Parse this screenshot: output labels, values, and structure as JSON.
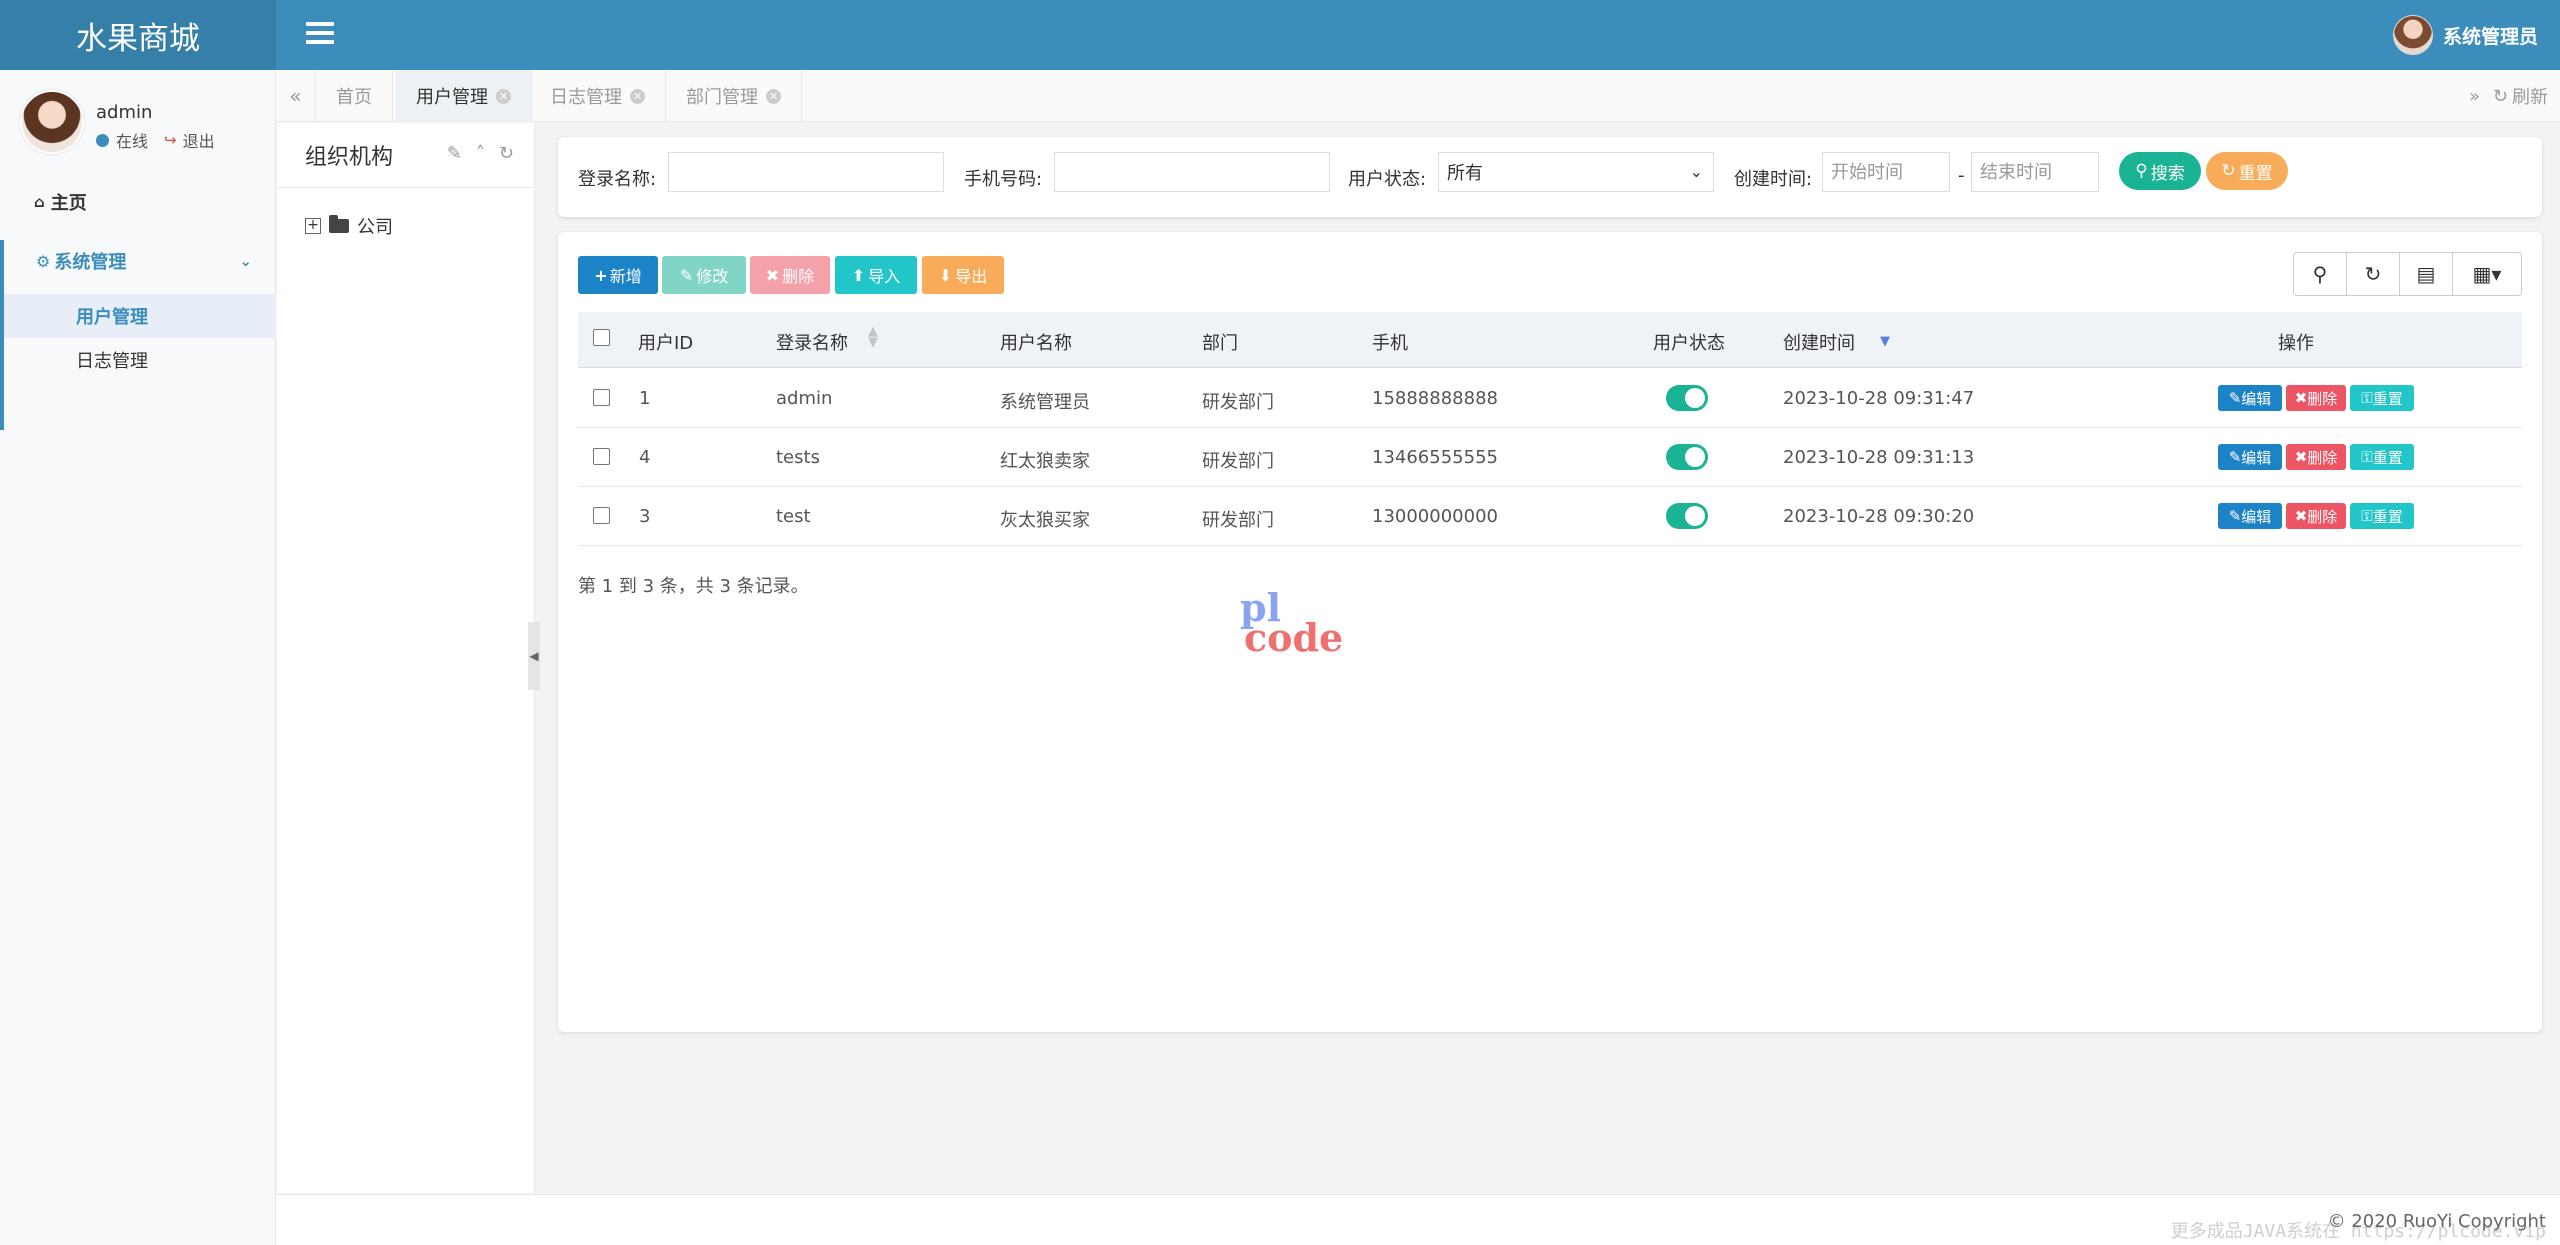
{
  "app": {
    "title": "水果商城"
  },
  "header": {
    "user_label": "系统管理员"
  },
  "sidebar": {
    "user": {
      "name": "admin",
      "status": "在线",
      "logout": "退出"
    },
    "home": "主页",
    "system": "系统管理",
    "items": [
      {
        "label": "用户管理"
      },
      {
        "label": "日志管理"
      }
    ]
  },
  "tabs": [
    {
      "label": "首页"
    },
    {
      "label": "用户管理"
    },
    {
      "label": "日志管理"
    },
    {
      "label": "部门管理"
    }
  ],
  "tabs_refresh": "刷新",
  "org": {
    "title": "组织机构",
    "root": "公司"
  },
  "search": {
    "login_label": "登录名称:",
    "phone_label": "手机号码:",
    "status_label": "用户状态:",
    "status_value": "所有",
    "time_label": "创建时间:",
    "start_placeholder": "开始时间",
    "dash": "-",
    "end_placeholder": "结束时间",
    "search_btn": "搜索",
    "reset_btn": "重置"
  },
  "toolbar": {
    "add": "新增",
    "edit": "修改",
    "delete": "删除",
    "import": "导入",
    "export": "导出"
  },
  "table": {
    "columns": [
      "用户ID",
      "登录名称",
      "用户名称",
      "部门",
      "手机",
      "用户状态",
      "创建时间",
      "操作"
    ],
    "rows": [
      {
        "id": "1",
        "login": "admin",
        "name": "系统管理员",
        "dept": "研发部门",
        "phone": "15888888888",
        "enabled": true,
        "created": "2023-10-28 09:31:47"
      },
      {
        "id": "4",
        "login": "tests",
        "name": "红太狼卖家",
        "dept": "研发部门",
        "phone": "13466555555",
        "enabled": true,
        "created": "2023-10-28 09:31:13"
      },
      {
        "id": "3",
        "login": "test",
        "name": "灰太狼买家",
        "dept": "研发部门",
        "phone": "13000000000",
        "enabled": true,
        "created": "2023-10-28 09:30:20"
      }
    ],
    "actions": {
      "edit": "编辑",
      "delete": "删除",
      "reset": "重置"
    }
  },
  "pager": "第 1 到 3 条，共 3 条记录。",
  "watermark": {
    "line1": "pl",
    "line2": "code"
  },
  "footer": {
    "copyright": "© 2020 RuoYi Copyright",
    "overlay": "更多成品JAVA系统在 https://plcode.vip"
  },
  "colors": {
    "primary": "#3c8dbc",
    "success": "#1ab394",
    "danger": "#ed5565",
    "info": "#23c6c8",
    "warning": "#f8ac59"
  }
}
